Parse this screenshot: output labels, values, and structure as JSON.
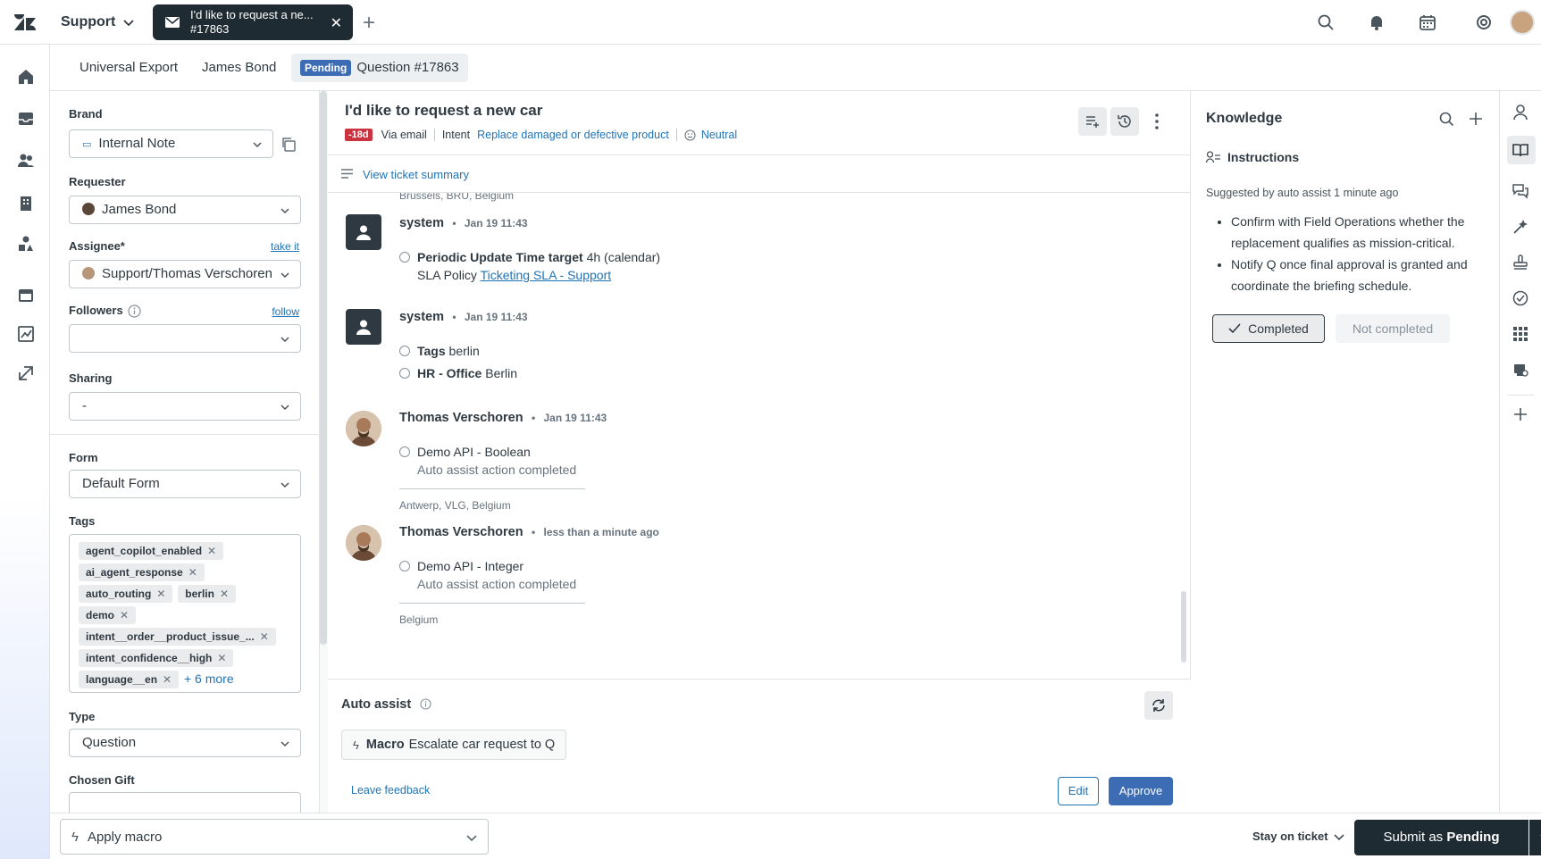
{
  "topbar": {
    "product": "Support",
    "ticket_tab": {
      "line1": "I'd like to request a ne...",
      "line2": "#17863"
    }
  },
  "context_tabs": {
    "org": "Universal Export",
    "user": "James Bond",
    "status_badge": "Pending",
    "ticket": "Question #17863"
  },
  "properties": {
    "brand_label": "Brand",
    "brand_value": "Internal Note",
    "requester_label": "Requester",
    "requester_value": "James Bond",
    "assignee_label": "Assignee*",
    "assignee_link": "take it",
    "assignee_value": "Support/Thomas Verschoren",
    "followers_label": "Followers",
    "followers_link": "follow",
    "followers_value": "",
    "sharing_label": "Sharing",
    "sharing_value": "-",
    "form_label": "Form",
    "form_value": "Default Form",
    "tags_label": "Tags",
    "tags": [
      "agent_copilot_enabled",
      "ai_agent_response",
      "auto_routing",
      "berlin",
      "demo",
      "intent__order__product_issue_...",
      "intent_confidence__high",
      "language__en"
    ],
    "tags_more": "+ 6 more",
    "type_label": "Type",
    "type_value": "Question",
    "gift_label": "Chosen Gift"
  },
  "ticket": {
    "subject": "I'd like to request a new car",
    "overdue": "-18d",
    "channel": "Via email",
    "intent_label": "Intent",
    "intent_value": "Replace damaged or defective product",
    "sentiment": "Neutral",
    "summary_link": "View ticket summary"
  },
  "feed": {
    "loc0": "Brussels, BRU, Belgium",
    "e1": {
      "author": "system",
      "time": "Jan 19 11:43",
      "line1_bold": "Periodic Update Time target",
      "line1_rest": " 4h (calendar)",
      "line2_pre": "SLA Policy ",
      "line2_link": "Ticketing SLA - Support"
    },
    "e2": {
      "author": "system",
      "time": "Jan 19 11:43",
      "tag_bold": "Tags",
      "tag_rest": " berlin",
      "hr_bold": "HR - Office",
      "hr_rest": " Berlin"
    },
    "e3": {
      "author": "Thomas Verschoren",
      "time": "Jan 19 11:43",
      "action": "Demo API - Boolean",
      "status": "Auto assist action completed",
      "loc": "Antwerp, VLG, Belgium"
    },
    "e4": {
      "author": "Thomas Verschoren",
      "time": "less than a minute ago",
      "action": "Demo API - Integer",
      "status": "Auto assist action completed",
      "loc": "Belgium"
    }
  },
  "assist": {
    "title": "Auto assist",
    "macro_bold": "Macro",
    "macro_name": "Escalate car request to Q",
    "feedback": "Leave feedback",
    "edit": "Edit",
    "approve": "Approve"
  },
  "knowledge": {
    "title": "Knowledge",
    "section": "Instructions",
    "suggested": "Suggested by auto assist 1 minute ago",
    "items": [
      "Confirm with Field Operations whether the replacement qualifies as mission-critical.",
      "Notify Q once final approval is granted and coordinate the briefing schedule."
    ],
    "completed": "Completed",
    "not_completed": "Not completed"
  },
  "bottombar": {
    "apply_macro": "Apply macro",
    "stay": "Stay on ticket",
    "submit_prefix": "Submit as ",
    "submit_status": "Pending"
  }
}
